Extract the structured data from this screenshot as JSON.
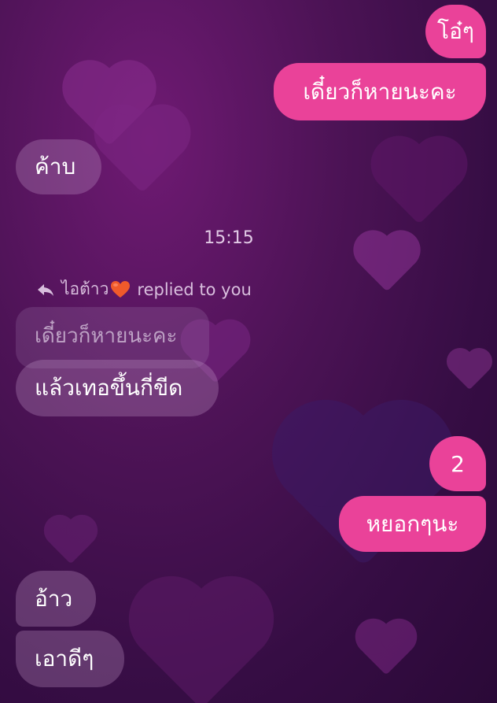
{
  "messages": {
    "m1": "โอ๋ๆ",
    "m2": "เดี๋ยวก็หายนะคะ",
    "m3": "ค้าบ",
    "time": "15:15",
    "reply_name": "ไอต้าว",
    "reply_text": "replied to you",
    "quoted": "เดี๋ยวก็หายนะคะ",
    "m4": "แล้วเทอขึ้นกี่ขีด",
    "m5": "2",
    "m6": "หยอกๆนะ",
    "m7": "อ้าว",
    "m8": "เอาดีๆ"
  },
  "icons": {
    "reply": "reply-arrow-icon",
    "heart_emoji": "❤️"
  },
  "colors": {
    "outgoing_bubble": "#ea4299",
    "background": "#4d1356"
  }
}
